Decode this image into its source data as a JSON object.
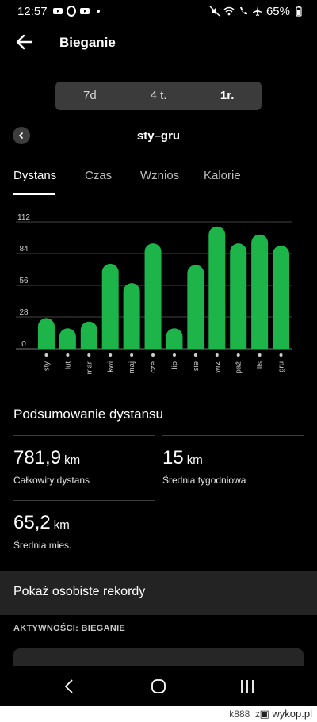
{
  "status_bar": {
    "time": "12:57",
    "battery": "65%"
  },
  "header": {
    "title": "Bieganie"
  },
  "range_selector": {
    "options": [
      "7d",
      "4 t.",
      "1r."
    ],
    "selected": "1r."
  },
  "period": {
    "label": "sty–gru"
  },
  "tabs": [
    {
      "label": "Dystans",
      "active": true
    },
    {
      "label": "Czas",
      "active": false
    },
    {
      "label": "Wznios",
      "active": false
    },
    {
      "label": "Kalorie",
      "active": false
    }
  ],
  "chart_data": {
    "type": "bar",
    "categories": [
      "sty",
      "lut",
      "mar",
      "kwi",
      "maj",
      "cze",
      "lip",
      "sie",
      "wrz",
      "paź",
      "lis",
      "gru"
    ],
    "values": [
      27,
      18,
      24,
      75,
      58,
      93,
      18,
      74,
      108,
      93,
      101,
      91
    ],
    "yticks": [
      0,
      28,
      56,
      84,
      112
    ],
    "ylim": [
      0,
      112
    ],
    "bar_color": "#1db54a",
    "grid": true
  },
  "summary": {
    "title": "Podsumowanie dystansu",
    "stats": [
      {
        "value": "781,9",
        "unit": "km",
        "label": "Całkowity dystans"
      },
      {
        "value": "15",
        "unit": "km",
        "label": "Średnia tygodniowa"
      },
      {
        "value": "65,2",
        "unit": "km",
        "label": "Średnia mies."
      }
    ]
  },
  "records": {
    "label": "Pokaż osobiste rekordy"
  },
  "activities": {
    "label": "AKTYWNOŚCI: BIEGANIE"
  },
  "watermark": {
    "user": "k888",
    "sep": "z",
    "site": "wykop.pl"
  },
  "colors": {
    "background": "#000000",
    "accent": "#1db54a",
    "surface": "#232323"
  }
}
